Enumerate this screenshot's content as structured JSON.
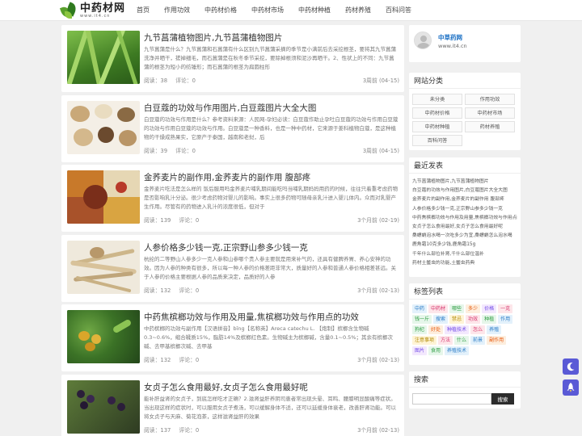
{
  "header": {
    "logo_title": "中药材网",
    "logo_url": "www.it4.cn",
    "nav": [
      "首页",
      "作用功效",
      "中药材价格",
      "中药材市场",
      "中药材种植",
      "药材养殖",
      "百科问答"
    ]
  },
  "posts": [
    {
      "title": "九节菖蒲植物图片,九节菖蒲植物图片",
      "excerpt": "九节菖蒲是什么？九节菖蒲和石菖蒲有什么区别九节菖蒲采摘的季节是小满前后去采挖根茎，要将其九节菖蒲洗净并晒干，搓掉细毛，而石菖蒲是在秋冬季节采挖，要除掉根须和泥沙再晒干。2、性状上的不同：九节菖蒲的根茎为短小的纺锤形；而石菖蒲的根茎为扁圆柱形",
      "views": "阅读：38",
      "comments": "评论：0",
      "date": "3周前 (04-15)"
    },
    {
      "title": "白豆蔻的功效与作用图片,白豆蔻图片大全大图",
      "excerpt": "白豆蔻的功效与作用是什么？参考资料来源：人民网-孕妇必读：白豆蔻作助止孕吐白豆蔻的功效与作用白豆蔻的功效与作用白豆蔻的功效与作用。白豆蔻是一种香料，也是一种中药材，它来源于姜科植物白蔻，是这种植物的干燥成熟果实，它原产于泰国，越南和老挝，后",
      "views": "阅读：39",
      "comments": "评论：0",
      "date": "3周前 (04-15)"
    },
    {
      "title": "金荞麦片的副作用,金荞麦片的副作用 腹部疼",
      "excerpt": "金荞麦片吃法是怎么样的 饭后服用吗金荞麦片哺乳期间能吃吗当哺乳期妈妈用药的时候，往往只着重考虑药物是否影响乳汁分泌。很少考虑药物对婴儿的影响。事实上很多药物可随母亲乳汁进入婴儿体内。众而对乳婴产生作用。尽管有的药物进入乳汁的浓度很低，但对于",
      "views": "阅读：139",
      "comments": "评论：0",
      "date": "3个月前 (02-19)"
    },
    {
      "title": "人参价格多少钱一克,正宗野山参多少钱一克",
      "excerpt": "杭纶的二等野山人参多少一克人参和山参哪个贵人参主要就是用来补气的，还具有健脾养胃、养心安神的功效。因为人参的种类有很多，所以每一种人参的价格差距非常大，质量好的人参和普通人参价格相差甚远。关于人参的价格主要根据人参的品质来决定，品质好的人参",
      "views": "阅读：132",
      "comments": "评论：0",
      "date": "3个月前 (02-13)"
    },
    {
      "title": "中药焦槟榔功效与作用及用量,焦槟榔功效与作用点的功效",
      "excerpt": "中药槟榔的功效与副作用【汉语拼音】bīng【名称英】Areca catechu L. 【炮制】槟榔含生物碱0.3~0.6%，缩合鞣质15%，脂肪14%及槟榔红色素。生物碱主为槟榔碱，含量0.1~0.5%；其余有槟榔次碱、去甲基槟榔次碱、去甲基",
      "views": "阅读：132",
      "comments": "评论：0",
      "date": "3个月前 (02-13)"
    },
    {
      "title": "女贞子怎么食用最好,女贞子怎么食用最好呢",
      "excerpt": "能补肝益肾的女贞子，到底怎样吃才正确？2.滋肾益肝养阴司患者常出现头晕、耳鸣、腰膝明显酸痛等症状。当出现这样的症状时，可以服用女贞子煮汤，可以缓解身体不适，还可以延缓身体衰老，改善肝肾功能。可以将女贞子与天麻、菊花泡茶，这样滋肾益肝的效果",
      "views": "阅读：137",
      "comments": "评论：0",
      "date": "3个月前 (02-13)"
    }
  ],
  "sidebar": {
    "author_name": "中草药网",
    "author_site": "www.it4.cn",
    "categories_title": "网站分类",
    "categories": [
      "未分类",
      "作用功效",
      "中药材价格",
      "中药材市场",
      "中药材种植",
      "药材养殖",
      "百科问答"
    ],
    "recent_title": "最近发表",
    "recent": [
      "九节菖蒲植物图片,九节菖蒲植物图片",
      "白豆蔻的功效与作用图片,白豆蔻图片大全大图",
      "金荞麦片的副作用,金荞麦片的副作用 腹部疼",
      "人参价格多少钱一克,正宗野山参多少钱一克",
      "中药焦槟榔功效与作用及用量,焦槟榔功效与作用点的功效",
      "女贞子怎么食用最好,女贞子怎么食用最好呢",
      "桑螵蛸泡水喝一次吃多少为宜,桑螵蛸怎么泡水喝",
      "鹿角霜10克多少钱,鹿角霜15g",
      "千年什么部位补肾,千什么部位温补",
      "药材土鳖虫的功能,土鳖虫药典"
    ],
    "tags_title": "标签列表",
    "tags": [
      "中药",
      "中药材",
      "哪些",
      "多少",
      "价格",
      "一克",
      "钱一斤",
      "搜索",
      "禁忌",
      "功效",
      "种植",
      "作用",
      "狗杞",
      "好处",
      "种植技术",
      "怎么",
      "养殖",
      "注意事项",
      "方法",
      "什么",
      "前景",
      "副作用",
      "图片",
      "食用",
      "养殖技术"
    ],
    "tag_colors": [
      [
        "#e3f1fb",
        "#2a7cc7"
      ],
      [
        "#fde6ea",
        "#d6336c"
      ],
      [
        "#e6f6ea",
        "#2f9e44"
      ],
      [
        "#fdeede",
        "#e8590c"
      ],
      [
        "#f3e8fd",
        "#7048e8"
      ],
      [
        "#fde6ea",
        "#d6336c"
      ],
      [
        "#e6f6ea",
        "#2f9e44"
      ],
      [
        "#e3f1fb",
        "#2a7cc7"
      ],
      [
        "#fff4d6",
        "#b08800"
      ],
      [
        "#fde6ea",
        "#d6336c"
      ],
      [
        "#e6f6ea",
        "#2f9e44"
      ],
      [
        "#e3f1fb",
        "#2a7cc7"
      ],
      [
        "#e6f6ea",
        "#2f9e44"
      ],
      [
        "#fdeede",
        "#e8590c"
      ],
      [
        "#f3e8fd",
        "#7048e8"
      ],
      [
        "#fde6ea",
        "#d6336c"
      ],
      [
        "#e3f1fb",
        "#2a7cc7"
      ],
      [
        "#fff4d6",
        "#b08800"
      ],
      [
        "#fde6ea",
        "#d6336c"
      ],
      [
        "#e6f6ea",
        "#2f9e44"
      ],
      [
        "#e3f1fb",
        "#2a7cc7"
      ],
      [
        "#fdeede",
        "#e8590c"
      ],
      [
        "#f3e8fd",
        "#7048e8"
      ],
      [
        "#e6f6ea",
        "#2f9e44"
      ],
      [
        "#e3f1fb",
        "#2a7cc7"
      ]
    ],
    "search_title": "搜索",
    "search_placeholder": "",
    "search_button": "搜索"
  },
  "colors": {
    "accent": "#1a6fc4",
    "float_button": "#5a5ad6",
    "search_button": "#2c2c2c"
  }
}
